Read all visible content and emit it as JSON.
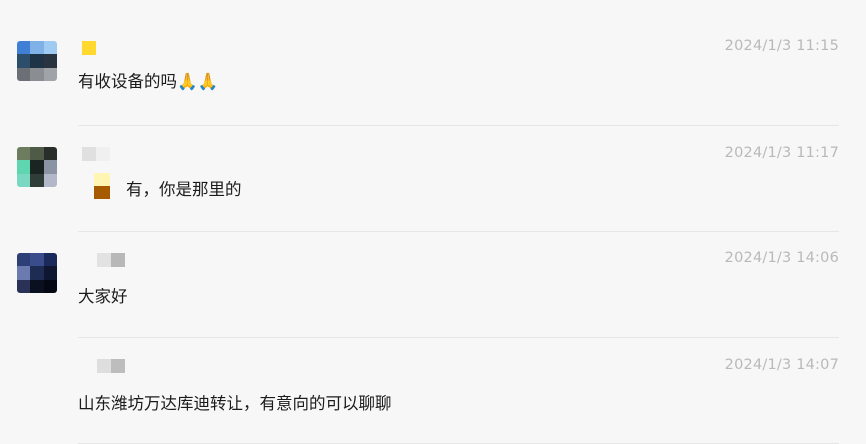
{
  "messages": [
    {
      "time": "2024/1/3 11:15",
      "text": "有收设备的吗🙏🙏",
      "avatar_colors": [
        "#3f7fd6",
        "#7fb1e6",
        "#9fcaf2",
        "#2c4e6a",
        "#1e3346",
        "#2a3440",
        "#6c7076",
        "#8a8e92",
        "#a0a4a8"
      ],
      "name_colors": [
        "#ffd92e"
      ]
    },
    {
      "time": "2024/1/3 11:17",
      "text": "有，你是那里的",
      "avatar_colors": [
        "#6d7b5e",
        "#4f5a47",
        "#2a2e2a",
        "#5fd6b0",
        "#1a2420",
        "#8a94a3",
        "#7ad8c2",
        "#2e3d36",
        "#b2b8c8"
      ],
      "name_colors": [
        "#e0e0e0",
        "#f0f0f0"
      ],
      "quote_colors": [
        "#fff6b3",
        "#a65b00"
      ]
    },
    {
      "time": "2024/1/3 14:06",
      "text": "大家好",
      "avatar_colors": [
        "#2d3f76",
        "#3a4c8c",
        "#1a2a5a",
        "#6b7bb0",
        "#1e2b52",
        "#0e1630",
        "#2a3258",
        "#0a1020",
        "#050812"
      ],
      "name_colors": [
        "#e2e2e2",
        "#b8b8b8"
      ]
    },
    {
      "time": "2024/1/3 14:07",
      "text": "山东潍坊万达库迪转让，有意向的可以聊聊",
      "avatar_colors": [],
      "name_colors": [
        "#dedede",
        "#bdbdbd"
      ]
    }
  ]
}
